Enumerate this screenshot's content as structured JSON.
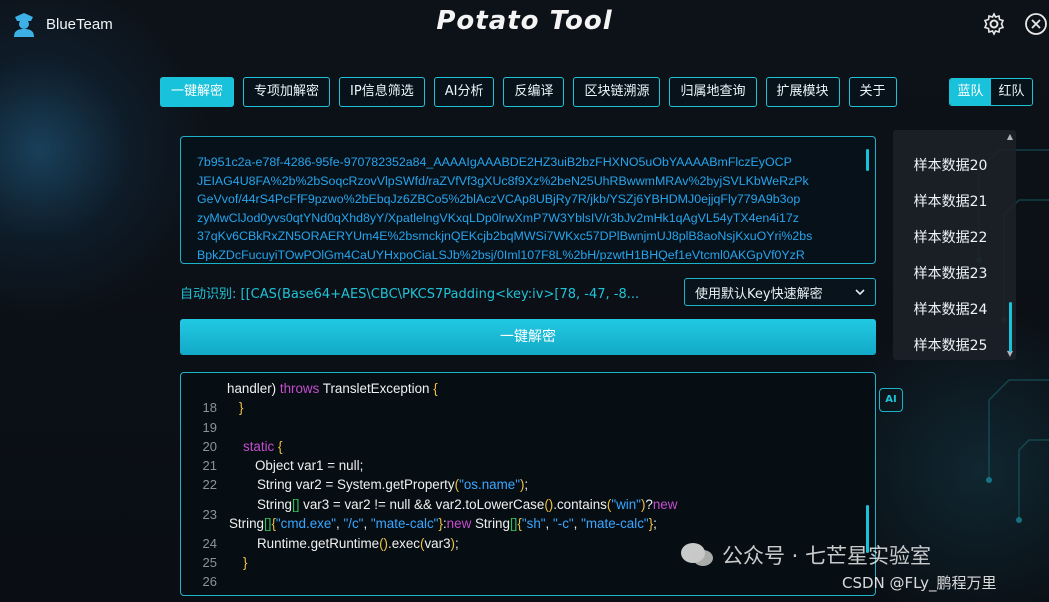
{
  "header": {
    "brand_name": "BlueTeam",
    "brand_icon": "police-officer-icon",
    "app_title": "Potato Tool",
    "settings_icon": "gear-icon",
    "close_icon": "close-icon"
  },
  "tabs": [
    {
      "label": "一键解密",
      "active": true
    },
    {
      "label": "专项加解密",
      "active": false
    },
    {
      "label": "IP信息筛选",
      "active": false
    },
    {
      "label": "AI分析",
      "active": false
    },
    {
      "label": "反编译",
      "active": false
    },
    {
      "label": "区块链溯源",
      "active": false
    },
    {
      "label": "归属地查询",
      "active": false
    },
    {
      "label": "扩展模块",
      "active": false
    },
    {
      "label": "关于",
      "active": false
    }
  ],
  "team_toggle": {
    "blue": "蓝队",
    "red": "红队",
    "selected": "蓝队"
  },
  "input": {
    "lines": [
      "7b951c2a-e78f-4286-95fe-970782352a84_AAAAIgAAABDE2HZ3uiB2bzFHXNO5uObYAAAABmFlczEyOCP",
      "JEIAG4U8FA%2b%2bSoqcRzovVlpSWfd/raZVfVf3gXUc8f9Xz%2beN25UhRBwwmMRAv%2byjSVLKbWeRzPk",
      "GeVvof/44rS4PcFfF9pzwo%2bEbqJz6ZBCo5%2blAczVCAp8UBjRy7R/jkb/YSZj6YBHDMJ0ejjqFly779A9b3op",
      "zyMwClJod0yvs0qtYNd0qXhd8yY/XpatlelngVKxqLDp0lrwXmP7W3YblsIV/r3bJv2mHk1qAgVL54yTX4en4i17z",
      "37qKv6CBkRxZN5ORAERYUm4E%2bsmckjnQEKcjb2bqMWSi7WKxc57DPlBwnjmUJ8plB8aoNsjKxuOYri%2bs",
      "BpkZDcFucuyiTOwPOlGm4CaUYHxpoCiaLSJb%2bsj/0Iml107F8L%2bH/pzwtH1BHQef1eVtcml0AKGpVf0YzR"
    ]
  },
  "auto_detect": {
    "label": "自动识别:",
    "value": "[[CAS(Base64+AES\\CBC\\PKCS7Padding<key:iv>[78, -47, -8..."
  },
  "mode_select": {
    "value": "使用默认Key快速解密",
    "icon": "chevron-down-icon"
  },
  "decrypt_button": "一键解密",
  "sample_list": {
    "items": [
      "样本数据20",
      "样本数据21",
      "样本数据22",
      "样本数据23",
      "样本数据24",
      "样本数据25"
    ]
  },
  "code": {
    "partial_top": "handler) throws TransletException {",
    "lines": [
      {
        "n": "18",
        "text": "}"
      },
      {
        "n": "19",
        "text": ""
      },
      {
        "n": "20",
        "text": "static {"
      },
      {
        "n": "21",
        "text": "Object var1 = null;"
      },
      {
        "n": "22",
        "text": "String var2 = System.getProperty(\"os.name\");"
      },
      {
        "n": "23",
        "text": "String[] var3 = var2 != null && var2.toLowerCase().contains(\"win\")?new String[]{\"cmd.exe\", \"/c\", \"mate-calc\"}:new String[]{\"sh\", \"-c\", \"mate-calc\"};"
      },
      {
        "n": "24",
        "text": "Runtime.getRuntime().exec(var3);"
      },
      {
        "n": "25",
        "text": "}"
      },
      {
        "n": "26",
        "text": "}"
      }
    ]
  },
  "ai_icon": "AI",
  "watermark": {
    "channel": "公众号 · 七芒星实验室",
    "csdn": "CSDN @FLy_鹏程万里"
  }
}
